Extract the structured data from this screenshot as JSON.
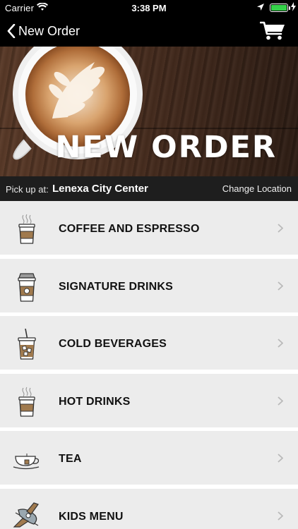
{
  "status_bar": {
    "carrier": "Carrier",
    "time": "3:38 PM",
    "battery_level": 1.0,
    "battery_color": "#35d24a"
  },
  "nav": {
    "back_label": "New Order"
  },
  "hero": {
    "title": "NEW ORDER"
  },
  "pickup": {
    "label": "Pick up at:",
    "location": "Lenexa City Center",
    "change_label": "Change Location"
  },
  "menu": {
    "items": [
      {
        "label": "COFFEE AND ESPRESSO",
        "icon": "hot-cup-icon"
      },
      {
        "label": "SIGNATURE DRINKS",
        "icon": "lidded-cup-icon"
      },
      {
        "label": "COLD BEVERAGES",
        "icon": "iced-cup-icon"
      },
      {
        "label": "HOT DRINKS",
        "icon": "hot-cup-icon"
      },
      {
        "label": "TEA",
        "icon": "teacup-icon"
      },
      {
        "label": "KIDS MENU",
        "icon": "airplane-icon"
      }
    ]
  },
  "colors": {
    "bar_background": "#000000",
    "pickup_background": "#1e1e1e",
    "item_background": "#ececec",
    "cup_sleeve": "#a07a4e"
  }
}
